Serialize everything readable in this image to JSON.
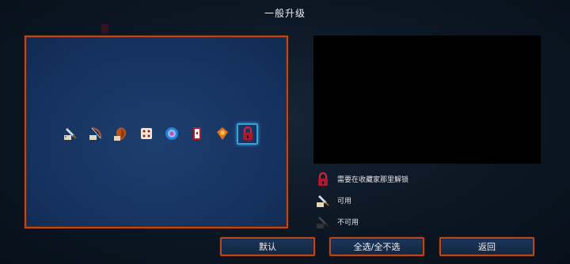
{
  "title": "一般升级",
  "legend": [
    {
      "icon": "red-padlock-icon",
      "label": "需要在收藏家那里解锁"
    },
    {
      "icon": "available-item-icon",
      "label": "可用"
    },
    {
      "icon": "unavailable-item-icon",
      "label": "不可用"
    }
  ],
  "items": [
    {
      "icon": "sword-scroll-icon",
      "state": "available"
    },
    {
      "icon": "bow-scroll-icon",
      "state": "available"
    },
    {
      "icon": "shield-scroll-icon",
      "state": "available"
    },
    {
      "icon": "dice-icon",
      "state": "available"
    },
    {
      "icon": "blue-orb-icon",
      "state": "available"
    },
    {
      "icon": "red-door-icon",
      "state": "available"
    },
    {
      "icon": "orange-amulet-icon",
      "state": "available"
    },
    {
      "icon": "red-padlock-icon",
      "state": "locked",
      "selected": true
    }
  ],
  "buttons": {
    "default": "默认",
    "select_all": "全选/全不选",
    "back": "返回"
  },
  "colors": {
    "accent_border": "#b9481a",
    "panel_bg": "#173462",
    "selection": "#3aa0d8"
  }
}
